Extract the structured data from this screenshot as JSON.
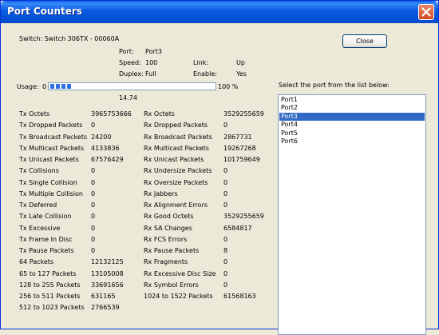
{
  "window": {
    "title": "Port Counters"
  },
  "header": {
    "switch": "Switch: Switch 306TX - 00060A",
    "port_label": "Port:",
    "port_value": "Port3",
    "speed_label": "Speed:",
    "speed_value": "100",
    "duplex_label": "Duplex:",
    "duplex_value": "Full",
    "link_label": "Link:",
    "link_value": "Up",
    "enable_label": "Enable:",
    "enable_value": "Yes",
    "close_label": "Close"
  },
  "usage": {
    "label": "Usage:",
    "min": "0",
    "max": "100 %",
    "value": "14.74",
    "fraction": 0.1474
  },
  "tx_counters": [
    {
      "label": "Tx Octets",
      "value": "3965753666"
    },
    {
      "label": "Tx Dropped Packets",
      "value": "0"
    },
    {
      "label": "Tx Broadcast Packets",
      "value": "24200"
    },
    {
      "label": "Tx Multicast Packets",
      "value": "4133836"
    },
    {
      "label": "Tx Unicast Packets",
      "value": "67576429"
    },
    {
      "label": "Tx Collisions",
      "value": "0"
    },
    {
      "label": "Tx Single Collision",
      "value": "0"
    },
    {
      "label": "Tx Multiple Collision",
      "value": "0"
    },
    {
      "label": "Tx Deferred",
      "value": "0"
    },
    {
      "label": "Tx Late Collision",
      "value": "0"
    },
    {
      "label": "Tx Excessive",
      "value": "0"
    },
    {
      "label": "Tx Frame In Disc",
      "value": "0"
    },
    {
      "label": "Tx Pause Packets",
      "value": "0"
    },
    {
      "label": "64 Packets",
      "value": "12132125"
    },
    {
      "label": "65 to 127 Packets",
      "value": "13105008"
    },
    {
      "label": "128 to 255 Packets",
      "value": "33691656"
    },
    {
      "label": "256 to 511 Packets",
      "value": "631165"
    },
    {
      "label": "512 to 1023 Packets",
      "value": "2766539"
    }
  ],
  "rx_counters": [
    {
      "label": "Rx Octets",
      "value": "3529255659"
    },
    {
      "label": "Rx Dropped Packets",
      "value": "0"
    },
    {
      "label": "Rx Broadcast Packets",
      "value": "2867731"
    },
    {
      "label": "Rx Multicast Packets",
      "value": "19267268"
    },
    {
      "label": "Rx Unicast Packets",
      "value": "101759649"
    },
    {
      "label": "Rx Undersize Packets",
      "value": "0"
    },
    {
      "label": "Rx Oversize Packets",
      "value": "0"
    },
    {
      "label": "Rx Jabbers",
      "value": "0"
    },
    {
      "label": "Rx Alignment Errors",
      "value": "0"
    },
    {
      "label": "Rx Good Octets",
      "value": "3529255659"
    },
    {
      "label": "Rx SA Changes",
      "value": "6584817"
    },
    {
      "label": "Rx FCS Errors",
      "value": "0"
    },
    {
      "label": "Rx Pause Packets",
      "value": "8"
    },
    {
      "label": "Rx Fragments",
      "value": "0"
    },
    {
      "label": "Rx Excessive Disc Size",
      "value": "0"
    },
    {
      "label": "Rx Symbol Errors",
      "value": "0"
    },
    {
      "label": "1024 to 1522 Packets",
      "value": "61568163"
    }
  ],
  "port_list": {
    "label": "Select the port from the list below:",
    "items": [
      "Port1",
      "Port2",
      "Port3",
      "Port4",
      "Port5",
      "Port6"
    ],
    "selected": "Port3"
  },
  "colors": {
    "titlebar": "#0A5BE0",
    "selection": "#316AC5",
    "progress": "#2F6DE1",
    "dialog": "#ECE9D8"
  }
}
